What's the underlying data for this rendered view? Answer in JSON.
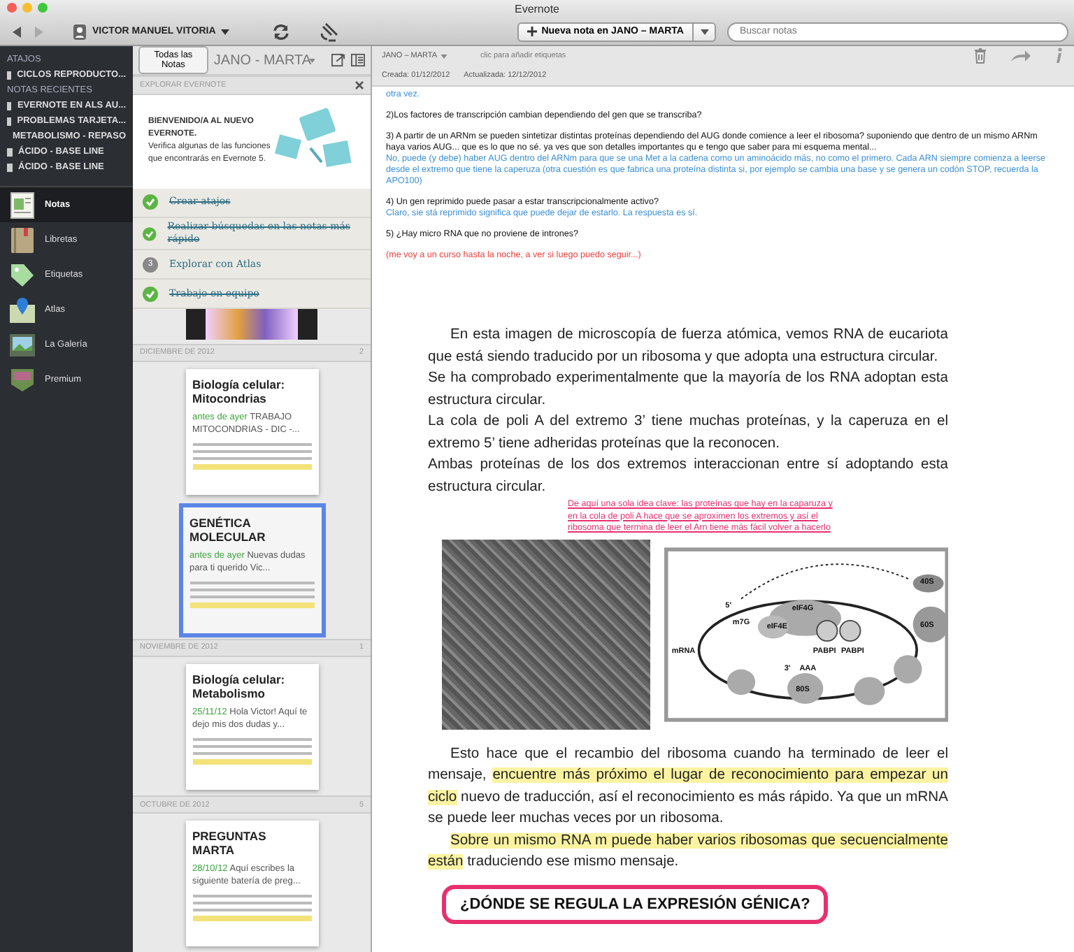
{
  "window": {
    "title": "Evernote"
  },
  "toolbar": {
    "user": "VICTOR MANUEL VITORIA",
    "new_note_button": "Nueva nota en JANO – MARTA",
    "search": {
      "placeholder": "Buscar notas"
    }
  },
  "sidebar": {
    "shortcuts_heading": "ATAJOS",
    "shortcuts": [
      "CICLOS REPRODUCTO..."
    ],
    "recent_heading": "NOTAS RECIENTES",
    "recent": [
      "EVERNOTE EN ALS AU...",
      "PROBLEMAS TARJETA...",
      "METABOLISMO - REPASO",
      "ÁCIDO - BASE LINE",
      "ÁCIDO - BASE LINE"
    ],
    "nav": [
      {
        "label": "Notas",
        "kind": "notes",
        "selected": true
      },
      {
        "label": "Libretas",
        "kind": "notebooks",
        "selected": false
      },
      {
        "label": "Etiquetas",
        "kind": "tags",
        "selected": false
      },
      {
        "label": "Atlas",
        "kind": "atlas",
        "selected": false
      },
      {
        "label": "La Galería",
        "kind": "gallery",
        "selected": false
      },
      {
        "label": "Premium",
        "kind": "premium",
        "selected": false
      }
    ]
  },
  "note_list": {
    "all_notes_button": "Todas las Notas",
    "notebook": "JANO - MARTA",
    "explore": {
      "heading": "EXPLORAR EVERNOTE",
      "title": "BIENVENIDO/A AL NUEVO EVERNOTE.",
      "text": "Verifica algunas de las funciones que encontrarás en Evernote 5.",
      "tasks": [
        {
          "label": "Crear atajos",
          "done": true
        },
        {
          "label": "Realizar búsquedas en las notas más rápido",
          "done": true
        },
        {
          "label": "Explorar con Atlas",
          "done": false,
          "number": "3"
        },
        {
          "label": "Trabajo en equipo",
          "done": true
        }
      ]
    },
    "groups": [
      {
        "heading": "DICIEMBRE DE 2012",
        "count": "2",
        "notes": [
          {
            "title": "Biología celular: Mitocondrias",
            "date": "antes de ayer",
            "snippet": "TRABAJO MITOCONDRIAS - DIC -...",
            "selected": false
          },
          {
            "title": "GENÉTICA MOLECULAR",
            "date": "antes de ayer",
            "snippet": "Nuevas dudas para ti querido Vic...",
            "selected": true
          }
        ]
      },
      {
        "heading": "NOVIEMBRE DE 2012",
        "count": "1",
        "notes": [
          {
            "title": "Biología celular: Metabolismo",
            "date": "25/11/12",
            "snippet": "Hola Victor! Aquí te dejo mis dos dudas y...",
            "selected": false
          }
        ]
      },
      {
        "heading": "OCTUBRE DE 2012",
        "count": "5",
        "notes": [
          {
            "title": "PREGUNTAS MARTA",
            "date": "28/10/12",
            "snippet": "Aquí escribes la siguiente batería de preg...",
            "selected": false
          }
        ]
      }
    ]
  },
  "note": {
    "notebook": "JANO – MARTA",
    "tags_placeholder": "clic para añadir etiquetas",
    "created": "Creada: 01/12/2012",
    "updated": "Actualizada: 12/12/2012",
    "qa": [
      {
        "kind": "answer",
        "text": "otra vez."
      },
      {
        "kind": "question",
        "text": "2)Los factores de transcripción cambian dependiendo del gen que se transcriba?"
      },
      {
        "kind": "question",
        "text": "3) A partir de un ARNm se pueden sintetizar distintas proteínas dependiendo del AUG donde comience a leer el ribosoma? suponiendo que dentro de un mismo ARNm haya varios AUG... que es lo que no sé. ya ves que son detalles importantes qu e tengo que saber para mi esquema mental..."
      },
      {
        "kind": "answer",
        "text": "No, puede (y debe) haber AUG dentro del ARNm para que se una Met a la cadena como un aminoácido más, no como el primero. Cada ARN siempre comienza a leerse desde el extremo que tiene la caperuza (otra cuestión es que fabrica una proteína distinta si, por ejemplo se cambia una base y se genera un codón STOP, recuerda la APO100)"
      },
      {
        "kind": "question",
        "text": "4) Un gen reprimido puede pasar a estar transcripcionalmente activo?"
      },
      {
        "kind": "answer",
        "text": "Claro, sie stá reprimido significa que puede dejar de estarlo. La respuesta es sí."
      },
      {
        "kind": "question",
        "text": "5) ¿Hay micro RNA que no proviene de intrones?"
      },
      {
        "kind": "comment",
        "text": "(me voy a un curso hasta la noche, a ver si luego puedo seguir...)"
      }
    ],
    "document": {
      "paragraphs": [
        {
          "indent": true,
          "segments": [
            {
              "text": "En esta imagen de microscopía de fuerza atómica, vemos RNA de eucariota que está siendo traducido por un ribosoma y que adopta una estructura circular.",
              "highlighted": false
            }
          ]
        },
        {
          "indent": false,
          "segments": [
            {
              "text": "Se ha comprobado experimentalmente que la mayoría de los RNA adoptan esta estructura circular.",
              "highlighted": false
            }
          ]
        },
        {
          "indent": false,
          "segments": [
            {
              "text": "La cola de poli A del extremo 3’ tiene muchas proteínas, y la caperuza en el extremo 5’ tiene adheridas proteínas que la reconocen.",
              "highlighted": false
            }
          ]
        },
        {
          "indent": false,
          "segments": [
            {
              "text": "Ambas proteínas de los dos extremos interaccionan entre sí adoptando esta estructura circular.",
              "highlighted": false
            }
          ]
        }
      ],
      "annotation": "De aquí una sola idea clave: las proteínas que hay en la caparuza y en la cola de poli A hace que se aproximen los extremos y así el ribosoma que termina de leer el Arn tiene más fácil volver a hacerlo",
      "diagram_labels": [
        "40S",
        "60S",
        "5'",
        "m7G",
        "eIF4E",
        "eIF4G",
        "PABPI",
        "PABPI",
        "3'",
        "AAA",
        "mRNA",
        "80S"
      ],
      "after": [
        {
          "indent": true,
          "segments": [
            {
              "text": "Esto hace que el recambio del ribosoma cuando ha terminado de leer el mensaje, ",
              "highlighted": false
            },
            {
              "text": "encuentre más próximo el lugar de reconocimiento para empezar un ciclo",
              "highlighted": true
            },
            {
              "text": " nuevo de traducción, así el reconocimiento es más rápido. Ya que un mRNA se puede leer muchas veces por un ribosoma.",
              "highlighted": false
            }
          ]
        },
        {
          "indent": true,
          "segments": [
            {
              "text": "Sobre un mismo RNA m puede haber varios ribosomas que secuencialmente están",
              "highlighted": true
            },
            {
              "text": " traduciendo ese mismo mensaje.",
              "highlighted": false
            }
          ]
        }
      ],
      "heading": "¿DÓNDE SE REGULA LA EXPRESIÓN GÉNICA?"
    }
  }
}
